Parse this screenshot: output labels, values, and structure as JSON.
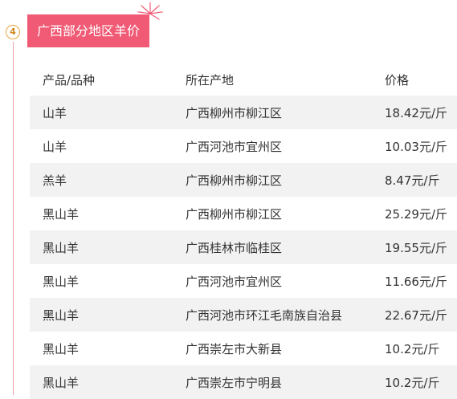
{
  "section": {
    "number": "4",
    "title": "广西部分地区羊价"
  },
  "table": {
    "headers": {
      "product": "产品/品种",
      "location": "所在产地",
      "price": "价格"
    },
    "rows": [
      {
        "product": "山羊",
        "location": "广西柳州市柳江区",
        "price": "18.42元/斤"
      },
      {
        "product": "山羊",
        "location": "广西河池市宜州区",
        "price": "10.03元/斤"
      },
      {
        "product": "羔羊",
        "location": "广西柳州市柳江区",
        "price": "8.47元/斤"
      },
      {
        "product": "黑山羊",
        "location": "广西柳州市柳江区",
        "price": "25.29元/斤"
      },
      {
        "product": "黑山羊",
        "location": "广西桂林市临桂区",
        "price": "19.55元/斤"
      },
      {
        "product": "黑山羊",
        "location": "广西河池市宜州区",
        "price": "11.66元/斤"
      },
      {
        "product": "黑山羊",
        "location": "广西河池市环江毛南族自治县",
        "price": "22.67元/斤"
      },
      {
        "product": "黑山羊",
        "location": "广西崇左市大新县",
        "price": "10.2元/斤"
      },
      {
        "product": "黑山羊",
        "location": "广西崇左市宁明县",
        "price": "10.2元/斤"
      }
    ]
  },
  "colors": {
    "title_background": "#f05a74",
    "badge_border": "#e9a33c",
    "timeline": "#e8a0a8",
    "stripe": "#f2f2f2"
  }
}
